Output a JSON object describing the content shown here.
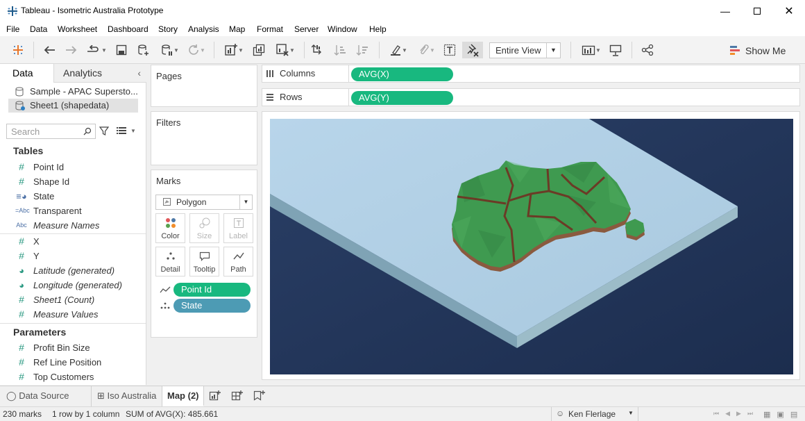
{
  "window": {
    "title": "Tableau - Isometric Australia Prototype"
  },
  "menu": [
    "File",
    "Data",
    "Worksheet",
    "Dashboard",
    "Story",
    "Analysis",
    "Map",
    "Format",
    "Server",
    "Window",
    "Help"
  ],
  "toolbar": {
    "fit_value": "Entire View",
    "show_me_label": "Show Me"
  },
  "data_pane": {
    "tabs": [
      "Data",
      "Analytics"
    ],
    "sources": [
      "Sample - APAC Supersto...",
      "Sheet1 (shapedata)"
    ],
    "search_placeholder": "Search",
    "tables_header": "Tables",
    "dimensions": [
      {
        "name": "Point Id",
        "icon": "#"
      },
      {
        "name": "Shape Id",
        "icon": "#"
      },
      {
        "name": "State",
        "icon": "geo"
      },
      {
        "name": "Transparent",
        "icon": "Abc"
      },
      {
        "name": "Measure Names",
        "icon": "Abc"
      }
    ],
    "measures": [
      {
        "name": "X",
        "icon": "#"
      },
      {
        "name": "Y",
        "icon": "#"
      },
      {
        "name": "Latitude (generated)",
        "icon": "geo"
      },
      {
        "name": "Longitude (generated)",
        "icon": "geo"
      },
      {
        "name": "Sheet1 (Count)",
        "icon": "#"
      },
      {
        "name": "Measure Values",
        "icon": "#"
      }
    ],
    "parameters_header": "Parameters",
    "parameters": [
      "Profit Bin Size",
      "Ref Line Position",
      "Top Customers"
    ]
  },
  "cards": {
    "pages": "Pages",
    "filters": "Filters",
    "marks": "Marks",
    "mark_type": "Polygon",
    "mark_buttons": [
      "Color",
      "Size",
      "Label",
      "Detail",
      "Tooltip",
      "Path"
    ],
    "mark_pills": [
      "Point Id",
      "State"
    ]
  },
  "shelves": {
    "columns_label": "Columns",
    "columns_pill": "AVG(X)",
    "rows_label": "Rows",
    "rows_pill": "AVG(Y)"
  },
  "sheet_tabs": [
    "Data Source",
    "Iso Australia",
    "Map (2)"
  ],
  "status": {
    "marks": "230 marks",
    "rows_cols": "1 row by 1 column",
    "sum": "SUM of AVG(X): 485.661",
    "user": "Ken Flerlage"
  },
  "colors": {
    "pill_green": "#18b87f",
    "pill_blue": "#4d9bb4",
    "viz_bg": "#22355a",
    "slab_top": "#b3d1e6",
    "land": "#3f9a50"
  }
}
